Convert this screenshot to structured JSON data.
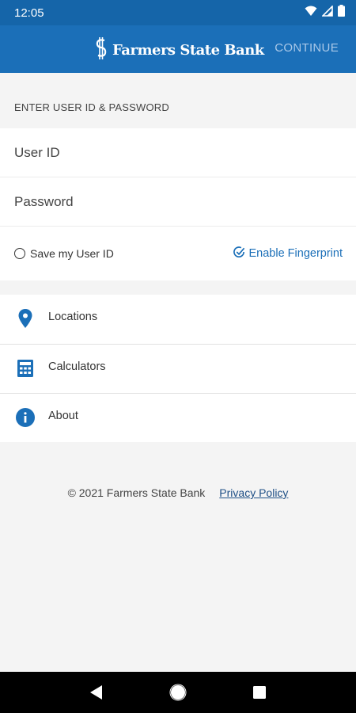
{
  "status_bar": {
    "time": "12:05",
    "icons": [
      "wifi-icon",
      "signal-icon",
      "battery-icon"
    ]
  },
  "app_bar": {
    "logo_text": "Farmers State Bank",
    "continue_label": "CONTINUE"
  },
  "login": {
    "section_header": "ENTER USER ID & PASSWORD",
    "user_id_placeholder": "User ID",
    "user_id_value": "",
    "password_placeholder": "Password",
    "password_value": "",
    "save_user_id_label": "Save my User ID",
    "save_user_id_checked": false,
    "enable_fingerprint_label": "Enable Fingerprint"
  },
  "menu": {
    "items": [
      {
        "label": "Locations",
        "icon": "location-pin-icon"
      },
      {
        "label": "Calculators",
        "icon": "calculator-icon"
      },
      {
        "label": "About",
        "icon": "info-icon"
      }
    ]
  },
  "footer": {
    "copyright": "© 2021 Farmers State Bank",
    "privacy_link": "Privacy Policy"
  },
  "colors": {
    "primary": "#1b6fb8",
    "status_bar": "#1565a9",
    "continue_disabled": "#a9c8e8",
    "link": "#1e4f86"
  }
}
